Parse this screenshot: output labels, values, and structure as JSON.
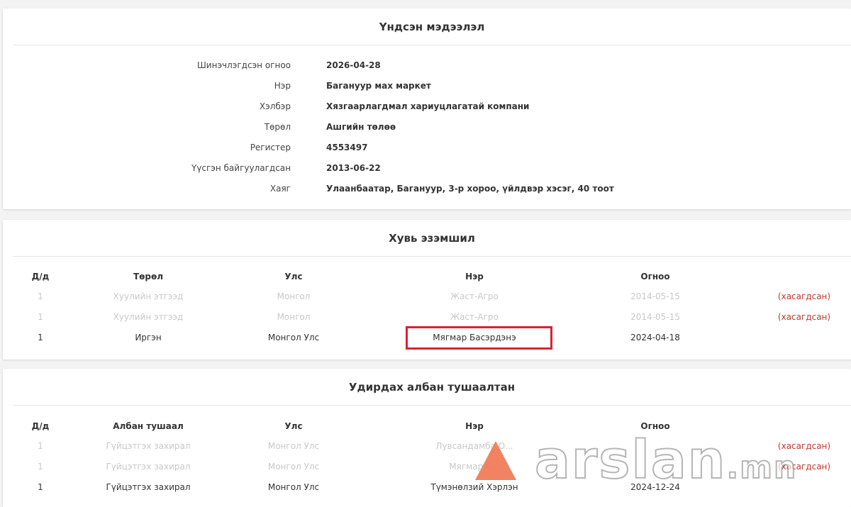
{
  "info": {
    "title": "Үндсэн мэдээлэл",
    "rows": [
      {
        "label": "Шинэчлэгдсэн огноо",
        "value": "2026-04-28"
      },
      {
        "label": "Нэр",
        "value": "Багануур мах маркет"
      },
      {
        "label": "Хэлбэр",
        "value": "Хязгаарлагдмал хариуцлагатай компани"
      },
      {
        "label": "Төрөл",
        "value": "Ашгийн төлөө"
      },
      {
        "label": "Регистер",
        "value": "4553497"
      },
      {
        "label": "Үүсгэн байгуулагдсан",
        "value": "2013-06-22"
      },
      {
        "label": "Хаяг",
        "value": "Улаанбаатар, Багануур, 3-р хороо, үйлдвэр хэсэг, 40 тоот"
      }
    ]
  },
  "owners": {
    "title": "Хувь эзэмшил",
    "headers": {
      "no": "Д/д",
      "type": "Төрөл",
      "country": "Улс",
      "name": "Нэр",
      "date": "Огноо"
    },
    "rows": [
      {
        "no": "1",
        "type": "Хуулийн этгээд",
        "country": "Монгол",
        "name": "Жаст-Агро",
        "date": "2014-05-15",
        "status": "(хасагдсан)"
      },
      {
        "no": "1",
        "type": "Хуулийн этгээд",
        "country": "Монгол",
        "name": "Жаст-Агро",
        "date": "2014-05-15",
        "status": "(хасагдсан)"
      },
      {
        "no": "1",
        "type": "Иргэн",
        "country": "Монгол Улс",
        "name": "Мягмар Басэрдэнэ",
        "date": "2024-04-18",
        "status": ""
      }
    ]
  },
  "officials": {
    "title": "Удирдах албан тушаалтан",
    "headers": {
      "no": "Д/д",
      "type": "Албан тушаал",
      "country": "Улс",
      "name": "Нэр",
      "date": "Огноо"
    },
    "rows": [
      {
        "no": "1",
        "type": "Гүйцэтгэх захирал",
        "country": "Монгол Улс",
        "name": "Лувсандамба О...",
        "date": "",
        "status": "(хасагдсан)"
      },
      {
        "no": "1",
        "type": "Гүйцэтгэх захирал",
        "country": "Монгол Улс",
        "name": "Мягмар Б...",
        "date": "",
        "status": "(хасагдсан)"
      },
      {
        "no": "1",
        "type": "Гүйцэтгэх захирал",
        "country": "Монгол Улс",
        "name": "Түмэнөлзий Хэрлэн",
        "date": "2024-12-24",
        "status": ""
      }
    ]
  },
  "watermark": {
    "text": "arslan",
    "suffix": ".mn"
  },
  "colors": {
    "removed": "#c0392b",
    "highlight": "#d9232e",
    "watermark_triangle": "#f07c5a"
  }
}
